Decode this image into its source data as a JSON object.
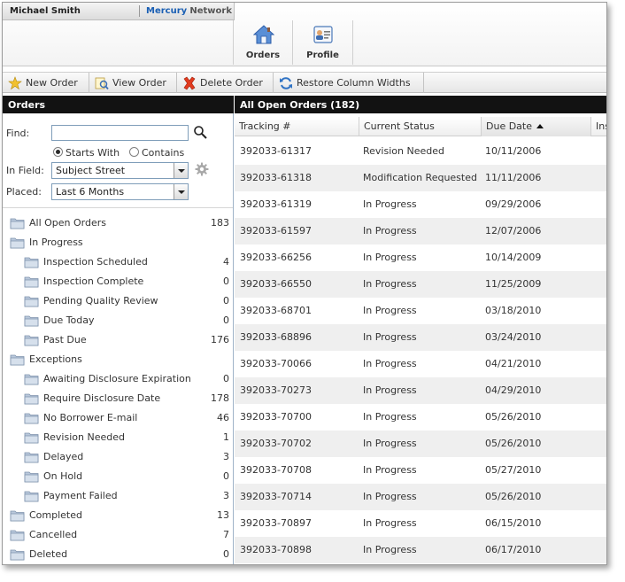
{
  "header": {
    "user_name": "Michael Smith",
    "network_brand": "Mercury",
    "network_rest": "Network",
    "buttons": [
      {
        "label": "Orders",
        "icon": "house-icon"
      },
      {
        "label": "Profile",
        "icon": "profile-card-icon"
      }
    ]
  },
  "toolbar": {
    "new_order": "New Order",
    "view_order": "View Order",
    "delete_order": "Delete Order",
    "restore_widths": "Restore Column Widths"
  },
  "orders_panel": {
    "title": "Orders",
    "find_label": "Find:",
    "find_value": "",
    "starts_with": "Starts With",
    "contains": "Contains",
    "selected_match": "Starts With",
    "in_field_label": "In Field:",
    "in_field_value": "Subject Street",
    "placed_label": "Placed:",
    "placed_value": "Last 6 Months",
    "tree": [
      {
        "label": "All Open Orders",
        "count": "183",
        "level": 0
      },
      {
        "label": "In Progress",
        "count": "",
        "level": 0
      },
      {
        "label": "Inspection Scheduled",
        "count": "4",
        "level": 1
      },
      {
        "label": "Inspection Complete",
        "count": "0",
        "level": 1
      },
      {
        "label": "Pending Quality Review",
        "count": "0",
        "level": 1
      },
      {
        "label": "Due Today",
        "count": "0",
        "level": 1
      },
      {
        "label": "Past Due",
        "count": "176",
        "level": 1
      },
      {
        "label": "Exceptions",
        "count": "",
        "level": 0
      },
      {
        "label": "Awaiting Disclosure Expiration",
        "count": "0",
        "level": 1
      },
      {
        "label": "Require Disclosure Date",
        "count": "178",
        "level": 1
      },
      {
        "label": "No Borrower E-mail",
        "count": "46",
        "level": 1
      },
      {
        "label": "Revision Needed",
        "count": "1",
        "level": 1
      },
      {
        "label": "Delayed",
        "count": "3",
        "level": 1
      },
      {
        "label": "On Hold",
        "count": "0",
        "level": 1
      },
      {
        "label": "Payment Failed",
        "count": "3",
        "level": 1
      },
      {
        "label": "Completed",
        "count": "13",
        "level": 0
      },
      {
        "label": "Cancelled",
        "count": "7",
        "level": 0
      },
      {
        "label": "Deleted",
        "count": "0",
        "level": 0
      }
    ]
  },
  "grid": {
    "title": "All Open Orders (182)",
    "columns": [
      "Tracking #",
      "Current Status",
      "Due Date",
      "Ins"
    ],
    "sort_column": "Due Date",
    "sort_direction": "ascending",
    "rows": [
      {
        "tracking": "392033-61317",
        "status": "Revision Needed",
        "due": "10/11/2006"
      },
      {
        "tracking": "392033-61318",
        "status": "Modification Requested",
        "due": "11/11/2006"
      },
      {
        "tracking": "392033-61319",
        "status": "In Progress",
        "due": "09/29/2006"
      },
      {
        "tracking": "392033-61597",
        "status": "In Progress",
        "due": "12/07/2006"
      },
      {
        "tracking": "392033-66256",
        "status": "In Progress",
        "due": "10/14/2009"
      },
      {
        "tracking": "392033-66550",
        "status": "In Progress",
        "due": "11/25/2009"
      },
      {
        "tracking": "392033-68701",
        "status": "In Progress",
        "due": "03/18/2010"
      },
      {
        "tracking": "392033-68896",
        "status": "In Progress",
        "due": "03/24/2010"
      },
      {
        "tracking": "392033-70066",
        "status": "In Progress",
        "due": "04/21/2010"
      },
      {
        "tracking": "392033-70273",
        "status": "In Progress",
        "due": "04/29/2010"
      },
      {
        "tracking": "392033-70700",
        "status": "In Progress",
        "due": "05/26/2010"
      },
      {
        "tracking": "392033-70702",
        "status": "In Progress",
        "due": "05/26/2010"
      },
      {
        "tracking": "392033-70708",
        "status": "In Progress",
        "due": "05/27/2010"
      },
      {
        "tracking": "392033-70714",
        "status": "In Progress",
        "due": "05/26/2010"
      },
      {
        "tracking": "392033-70897",
        "status": "In Progress",
        "due": "06/15/2010"
      },
      {
        "tracking": "392033-70898",
        "status": "In Progress",
        "due": "06/17/2010"
      }
    ]
  },
  "colors": {
    "panel_header_bg": "#121212",
    "brand_blue": "#1a5fb4",
    "row_alt": "#efefef"
  }
}
